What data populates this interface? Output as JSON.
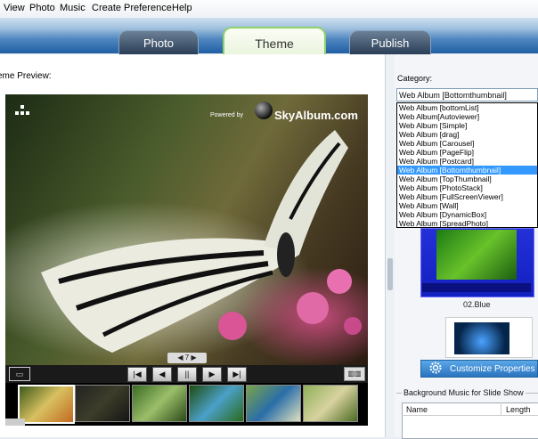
{
  "menu": [
    "View",
    "Photo",
    "Music",
    "Create",
    "Preference",
    "Help"
  ],
  "tabs": [
    {
      "label": "Photo",
      "active": false
    },
    {
      "label": "Theme",
      "active": true
    },
    {
      "label": "Publish",
      "active": false
    }
  ],
  "preview": {
    "label": "eme Preview:",
    "powered_by": "Powered by",
    "brand": "SkyAlbum.com",
    "pager": "◀ 7 ▶"
  },
  "controls": [
    "|◀",
    "◀",
    "||",
    "▶",
    "▶|"
  ],
  "category": {
    "label": "Category:",
    "selected": "Web Album [Bottomthumbnail]",
    "options": [
      "Web Album [bottomList]",
      "Web Album[Autoviewer]",
      "Web Album [Simple]",
      "Web Album [drag]",
      "Web Album [Carousel]",
      "Web Album [PageFlip]",
      "Web Album [Postcard]",
      "Web Album [Bottomthumbnail]",
      "Web Album [TopThumbnail]",
      "Web Album [PhotoStack]",
      "Web Album [FullScreenViewer]",
      "Web Album [Wall]",
      "Web Album [DynamicBox]",
      "Web Album [SpreadPhoto]"
    ],
    "selected_index": 7
  },
  "theme_name": "02.Blue",
  "customize_label": "Customize Properties",
  "bgm": {
    "label": "Background Music for Slide Show",
    "col_name": "Name",
    "col_length": "Length"
  },
  "colors": {
    "accent": "#2a74bf",
    "tab_active_border": "#8fd16a",
    "list_selected": "#3399ff"
  }
}
